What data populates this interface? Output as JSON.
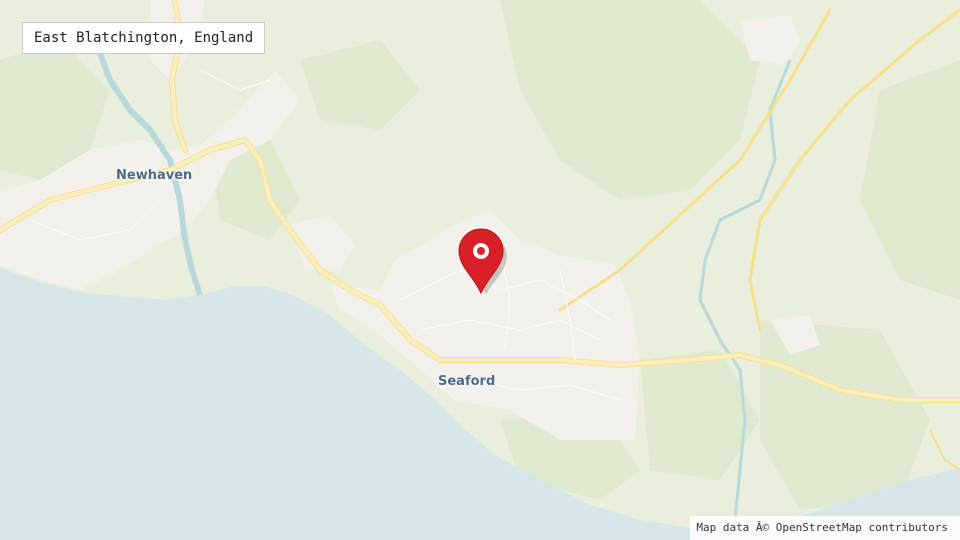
{
  "map": {
    "location_title": "East Blatchington, England",
    "attribution": "Map data Â© OpenStreetMap contributors",
    "places": [
      {
        "name": "Newhaven"
      },
      {
        "name": "Seaford"
      }
    ],
    "marker": {
      "icon": "map-pin-icon",
      "color": "#d92027"
    },
    "colors": {
      "land": "#e9efdc",
      "woodland": "#dfe9cf",
      "sea": "#d6e6e8",
      "urban": "#f4f1ec",
      "road_major": "#fbe9a8",
      "river": "#b9d8dc"
    }
  }
}
